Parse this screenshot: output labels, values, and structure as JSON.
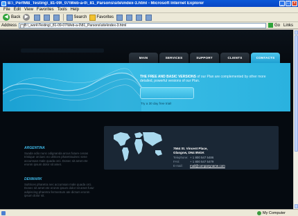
{
  "window": {
    "title": "B:\\_PerfMB_Testing\\_81-09\\_07\\Web-a-0\\_81_Parsons\\site\\index-3.html - Microsoft Internet Explorer",
    "minimize": "_",
    "maximize": "□",
    "close": "×"
  },
  "menu": {
    "items": [
      "File",
      "Edit",
      "View",
      "Favorites",
      "Tools",
      "Help"
    ]
  },
  "toolbar": {
    "back_label": "Back",
    "search_label": "Search",
    "favorites_label": "Favorites"
  },
  "address": {
    "label": "Address",
    "url": "B:\\_work\\Testing\\_81-09-07\\Web-a-0\\81_Parsons\\site\\index-3.html",
    "go_label": "Go",
    "links_label": "Links"
  },
  "site": {
    "nav": [
      "MAIN",
      "SERVICES",
      "SUPPORT",
      "CLIENTS",
      "CONTACTS"
    ],
    "active_nav": "CONTACTS",
    "hero": {
      "headline_bold": "THE FREE AND BASIC VERSIONS",
      "headline_rest": " of our Plan are complemented by other more detailed, powerful versions of our Plan.",
      "note": "Try a 30 day free trial!"
    },
    "contact": {
      "address_line1": "7564 St. Vincent Place,",
      "address_line2": "Glasgow, DN4 8NGK",
      "telephone_label": "Telephone:",
      "telephone_value": "+ 1 800 547 5486",
      "fax_label": "FAX:",
      "fax_value": "+ 1 800 547 5479",
      "email_label": "E-mail:",
      "email_value": "mail@companyname.com"
    },
    "sections": [
      {
        "heading": "ARGENTINA",
        "body": "Suada odio nunc odignanda arcus future cenas tristique orciuec eo ultrices pharetrauinec sene accumsan male quada orci. Donec sit amet ete eronm ipsum dolor sit amet."
      },
      {
        "heading": "DENMARK",
        "body": "Sultrices pharetra nec accumsan male quada orci. Donec sit amet ete eronm ipsum dolor sit amet futur adipiscing pharetra fermentum ate dictum eronm ipsum dolor sit."
      }
    ]
  },
  "status": {
    "zone": "My Computer"
  },
  "colors": {
    "accent": "#2ab2df",
    "page_bg": "#050a10",
    "panel_bg": "#1a2735",
    "heading": "#3fb7e6"
  }
}
